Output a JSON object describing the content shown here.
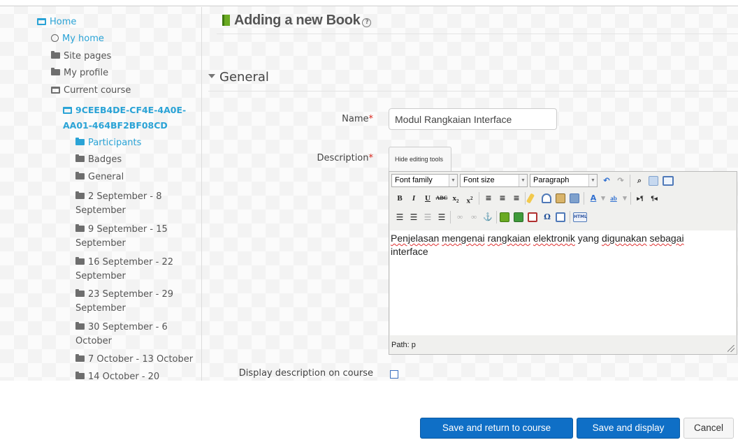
{
  "sidebar": {
    "home": "Home",
    "my_home": "My home",
    "site_pages": "Site pages",
    "my_profile": "My profile",
    "current_course": "Current course",
    "course_code_line1": "9CEEB4DE-CF4E-4A0E-",
    "course_code_line2": "AA01-464BF2BF08CD",
    "participants": "Participants",
    "badges": "Badges",
    "general": "General",
    "weeks": [
      {
        "line1": "2 September - 8",
        "line2": "September"
      },
      {
        "line1": "9 September - 15",
        "line2": "September"
      },
      {
        "line1": "16 September - 22",
        "line2": "September"
      },
      {
        "line1": "23 September - 29",
        "line2": "September"
      },
      {
        "line1": "30 September - 6",
        "line2": "October"
      },
      {
        "line1": "7 October - 13 October",
        "line2": ""
      },
      {
        "line1": "14 October - 20",
        "line2": ""
      }
    ]
  },
  "page": {
    "title": "Adding a new Book",
    "help_symbol": "?",
    "section_title": "General"
  },
  "form": {
    "name_label": "Name",
    "required_mark": "*",
    "name_value": "Modul Rangkaian Interface",
    "description_label": "Description",
    "hide_tools_label": "Hide editing tools",
    "font_family": "Font family",
    "font_size": "Font size",
    "paragraph": "Paragraph",
    "desc_words": [
      "Penjelasan",
      "mengenai",
      "rangkaian",
      "elektronik",
      "yang",
      "digunakan",
      "sebagai"
    ],
    "desc_line2": "interface",
    "path_text": "Path: p",
    "display_description_label": "Display description on course",
    "display_description_checked": false
  },
  "buttons": {
    "save_return": "Save and return to course",
    "save_display": "Save and display",
    "cancel": "Cancel"
  },
  "colors": {
    "link": "#2aa3d6",
    "primary_button": "#0f6fc6",
    "required": "#d9261c",
    "book_icon": "#6aaa22"
  }
}
